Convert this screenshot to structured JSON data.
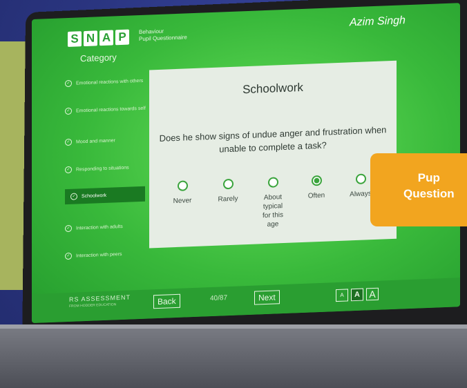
{
  "header": {
    "logo_letters": [
      "S",
      "N",
      "A",
      "P"
    ],
    "product_line1": "Behaviour",
    "product_line2": "Pupil Questionnaire",
    "user_name": "Azim Singh"
  },
  "sidebar": {
    "title": "Category",
    "items": [
      {
        "label": "Emotional reactions with others"
      },
      {
        "label": "Emotional reactions towards self"
      },
      {
        "label": "Mood and manner"
      },
      {
        "label": "Responding to situations"
      },
      {
        "label": "Schoolwork"
      },
      {
        "label": "Interaction with adults"
      },
      {
        "label": "Interaction with peers"
      }
    ]
  },
  "card": {
    "title": "Schoolwork",
    "question": "Does he show signs of undue anger and frustration when unable to complete a task?",
    "options": [
      "Never",
      "Rarely",
      "About typical for this age",
      "Often",
      "Always"
    ],
    "selected": "Often"
  },
  "footer": {
    "brand": "RS ASSESSMENT",
    "brand_sub": "FROM HODDER EDUCATION",
    "back_label": "Back",
    "page_count": "40/87",
    "next_label": "Next",
    "text_sizes": [
      "A",
      "A",
      "A"
    ]
  },
  "badge": {
    "line1": "Pup",
    "line2": "Question"
  },
  "colors": {
    "screen_green": "#3cbc3a",
    "accent_orange": "#f2a51f",
    "navy_bg": "#2e3a86"
  }
}
